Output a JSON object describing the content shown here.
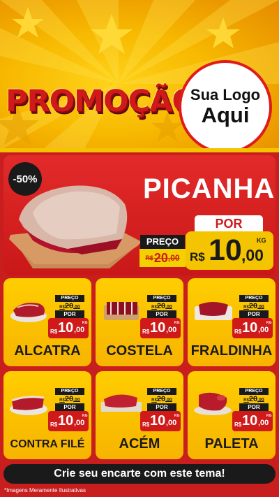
{
  "header": {
    "title": "PROMOÇÃO",
    "logo_line1": "Sua Logo",
    "logo_line2": "Aqui"
  },
  "hero": {
    "discount": "-50%",
    "name": "PICANHA",
    "preco_label": "PREÇO",
    "old_currency": "R$",
    "old_value": "20",
    "old_cents": ",00",
    "por_label": "POR",
    "currency": "R$",
    "price": "10",
    "cents": ",00",
    "unit": "KG"
  },
  "products": [
    {
      "name": "ALCATRA",
      "preco_label": "PREÇO",
      "old_currency": "R$",
      "old_value": "20",
      "old_cents": ",00",
      "por_label": "POR",
      "currency": "R$",
      "price": "10",
      "cents": ",00",
      "unit": "KG"
    },
    {
      "name": "COSTELA",
      "preco_label": "PREÇO",
      "old_currency": "R$",
      "old_value": "20",
      "old_cents": ",00",
      "por_label": "POR",
      "currency": "R$",
      "price": "10",
      "cents": ",00",
      "unit": "KG"
    },
    {
      "name": "FRALDINHA",
      "preco_label": "PREÇO",
      "old_currency": "R$",
      "old_value": "20",
      "old_cents": ",00",
      "por_label": "POR",
      "currency": "R$",
      "price": "10",
      "cents": ",00",
      "unit": "KG"
    },
    {
      "name": "CONTRA FILÉ",
      "preco_label": "PREÇO",
      "old_currency": "R$",
      "old_value": "20",
      "old_cents": ",00",
      "por_label": "POR",
      "currency": "R$",
      "price": "10",
      "cents": ",00",
      "unit": "KG"
    },
    {
      "name": "ACÉM",
      "preco_label": "PREÇO",
      "old_currency": "R$",
      "old_value": "20",
      "old_cents": ",00",
      "por_label": "POR",
      "currency": "R$",
      "price": "10",
      "cents": ",00",
      "unit": "KG"
    },
    {
      "name": "PALETA",
      "preco_label": "PREÇO",
      "old_currency": "R$",
      "old_value": "20",
      "old_cents": ",00",
      "por_label": "POR",
      "currency": "R$",
      "price": "10",
      "cents": ",00",
      "unit": "KG"
    }
  ],
  "footer": {
    "cta": "Crie seu encarte com este tema!",
    "note": "*Imagens Meramente Ilustrativas"
  },
  "colors": {
    "background_red": "#c81e1e",
    "yellow": "#f4c400",
    "dark": "#1a1a1a",
    "price_red": "#d01a1a"
  }
}
